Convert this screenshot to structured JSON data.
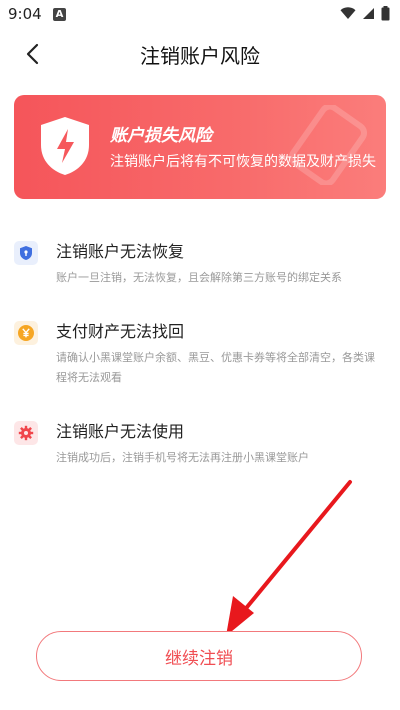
{
  "statusbar": {
    "time": "9:04",
    "notif_letter": "A"
  },
  "header": {
    "title": "注销账户风险"
  },
  "banner": {
    "title": "账户损失风险",
    "subtitle": "注销账户后将有不可恢复的数据及财产损失"
  },
  "items": [
    {
      "title": "注销账户无法恢复",
      "desc": "账户一旦注销，无法恢复，且会解除第三方账号的绑定关系",
      "icon": "shield-lock-icon",
      "color": "#3f6fe0"
    },
    {
      "title": "支付财产无法找回",
      "desc": "请确认小黑课堂账户余额、黑豆、优惠卡券等将全部清空，各类课程将无法观看",
      "icon": "yen-coin-icon",
      "color": "#f6a623"
    },
    {
      "title": "注销账户无法使用",
      "desc": "注销成功后，注销手机号将无法再注册小黑课堂账户",
      "icon": "gear-icon",
      "color": "#f0454b"
    }
  ],
  "continue_button": {
    "label": "继续注销"
  },
  "colors": {
    "accent": "#f0454b",
    "banner": "#f6585c",
    "arrow": "#e8181d"
  }
}
